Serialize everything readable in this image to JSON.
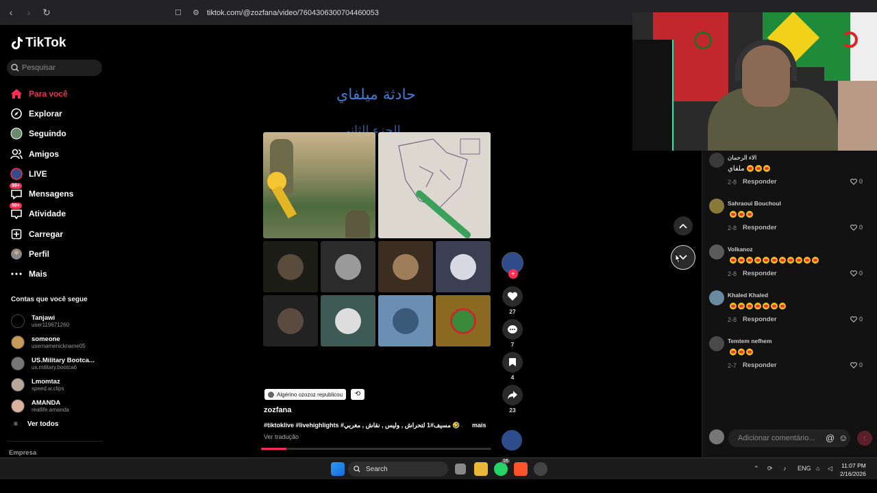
{
  "browser": {
    "url": "tiktok.com/@zozfana/video/7604306300704460053"
  },
  "sidebar": {
    "logo": "TikTok",
    "search_placeholder": "Pesquisar",
    "menu": [
      {
        "label": "Para você",
        "icon": "home-icon",
        "active": true
      },
      {
        "label": "Explorar",
        "icon": "compass-icon"
      },
      {
        "label": "Seguindo",
        "icon": "following-avatar-icon"
      },
      {
        "label": "Amigos",
        "icon": "friends-icon"
      },
      {
        "label": "LIVE",
        "icon": "live-icon"
      },
      {
        "label": "Mensagens",
        "icon": "messages-icon",
        "badge": "99+"
      },
      {
        "label": "Atividade",
        "icon": "activity-icon",
        "badge": "99+"
      },
      {
        "label": "Carregar",
        "icon": "upload-icon"
      },
      {
        "label": "Perfil",
        "icon": "profile-icon"
      },
      {
        "label": "Mais",
        "icon": "more-icon"
      }
    ],
    "follow_title": "Contas que você segue",
    "following": [
      {
        "name": "Tanjawi",
        "user": "user119671260",
        "color": "#000"
      },
      {
        "name": "someone",
        "user": "usernamenickname05",
        "color": "#c89a5a"
      },
      {
        "name": "US.Military Bootca...",
        "user": "us.military.bootca6",
        "color": "#777"
      },
      {
        "name": "Lmomtaz",
        "user": "speed.w.clips",
        "color": "#b9a89a"
      },
      {
        "name": "AMANDA",
        "user": "reallife.amanda",
        "color": "#d9b3a0"
      }
    ],
    "ver_todos": "Ver todos",
    "empresa": "Empresa"
  },
  "video": {
    "title_ar": "حادثة ميلفاي",
    "subtitle_ar": "الجزء الثاني",
    "tag": "Algérino ozozoz republicou",
    "author": "zozfana",
    "caption": "#tiktoklive #livehighlights #مسيف#1 لتحراش , وليس , نقاش , مغربي 🤣 ...",
    "mais": "mais",
    "ver_traducao": "Ver tradução",
    "progress": 0.11
  },
  "actions": {
    "likes": "27",
    "comments": "7",
    "saves": "4",
    "shares": "23"
  },
  "comments": [
    {
      "name": "الاء الرحمان",
      "text": "ملفاي",
      "emoji": 3,
      "date": "2-8",
      "likes": "0",
      "color": "#3a3a3a"
    },
    {
      "name": "Sahraoui Bouchoul",
      "text": "",
      "emoji": 3,
      "date": "2-8",
      "likes": "0",
      "color": "#8a7a3a"
    },
    {
      "name": "Volkanoz",
      "text": "",
      "emoji": 11,
      "date": "2-8",
      "likes": "0",
      "color": "#5a5a5a"
    },
    {
      "name": "Khaled Khaled",
      "text": "",
      "emoji": 7,
      "date": "2-8",
      "likes": "0",
      "color": "#6a8aa0"
    },
    {
      "name": "Temtem nefhem",
      "text": "",
      "emoji": 3,
      "date": "2-7",
      "likes": "0",
      "color": "#4a4a4a"
    }
  ],
  "comment_labels": {
    "reply": "Responder",
    "placeholder": "Adicionar comentário..."
  },
  "taskbar": {
    "search": "Search",
    "lang": "ENG",
    "time": "11:07 PM",
    "date": "2/16/2026",
    "whatsapp_badge": "16"
  }
}
